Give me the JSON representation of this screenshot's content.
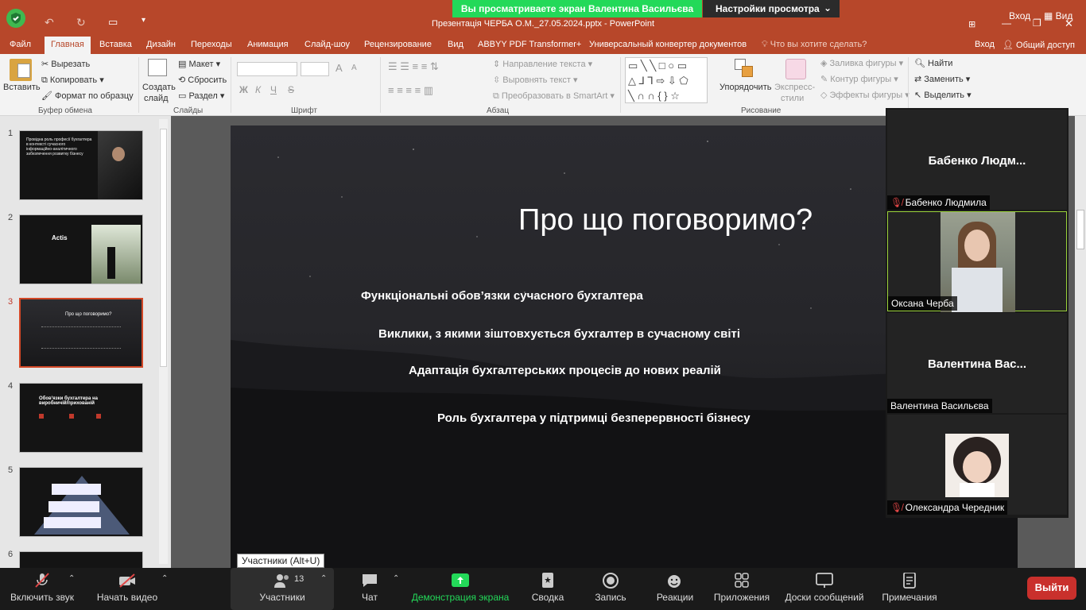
{
  "share_banner": {
    "text": "Вы просматриваете экран Валентина Васильєва",
    "view_options": "Настройки просмотра"
  },
  "window": {
    "title": "Презентація ЧЕРБА О.М._27.05.2024.pptx - PowerPoint",
    "login_top": "Вход",
    "view_btn": "Вид",
    "login": "Вход",
    "share": "Общий доступ"
  },
  "menu": [
    "Файл",
    "Главная",
    "Вставка",
    "Дизайн",
    "Переходы",
    "Анимация",
    "Слайд-шоу",
    "Рецензирование",
    "Вид",
    "ABBYY PDF Transformer+",
    "Универсальный конвертер документов"
  ],
  "tell_me": "Что вы хотите сделать?",
  "ribbon": {
    "paste": "Вставить",
    "cut": "Вырезать",
    "copy": "Копировать",
    "format_painter": "Формат по образцу",
    "new_slide_1": "Создать",
    "new_slide_2": "слайд",
    "layout": "Макет",
    "reset": "Сбросить",
    "section": "Раздел",
    "bold": "Ж",
    "italic": "К",
    "underline": "Ч",
    "strike": "S",
    "font_grow": "A",
    "font_shrink": "A",
    "text_direction": "Направление текста",
    "align_text": "Выровнять текст",
    "smartart": "Преобразовать в SmartArt",
    "arrange": "Упорядочить",
    "quick_styles_1": "Экспресс-",
    "quick_styles_2": "стили",
    "shape_fill": "Заливка фигуры",
    "shape_outline": "Контур фигуры",
    "shape_effects": "Эффекты фигуры",
    "find": "Найти",
    "replace": "Заменить",
    "select": "Выделить",
    "groups": {
      "clipboard": "Буфер обмена",
      "slides": "Слайды",
      "font": "Шрифт",
      "paragraph": "Абзац",
      "drawing": "Рисование"
    }
  },
  "thumbs": [
    {
      "num": "1",
      "text": "Провідна роль професії бухгалтера в контексті сучасного інформаційно-аналітичного забезпечення розвитку бізнесу"
    },
    {
      "num": "2",
      "text": "Actis"
    },
    {
      "num": "3",
      "text": "Про що поговоримо?"
    },
    {
      "num": "4",
      "text": "Обов'язки бухгалтера на виробничій/прихованій"
    },
    {
      "num": "5",
      "text": ""
    },
    {
      "num": "6",
      "text": ""
    }
  ],
  "slide": {
    "title": "Про що поговоримо?",
    "items": [
      "Функціональні обов’язки сучасного бухгалтера",
      "Виклики, з якими зіштовхується бухгалтер в сучасному світі",
      "Адаптація бухгалтерських процесів до нових реалій",
      "Роль бухгалтера у підтримці безперервності бізнесу"
    ]
  },
  "tooltip": "Участники (Alt+U)",
  "gallery": [
    {
      "big": "Бабенко  Людм...",
      "name": "Бабенко Людмила",
      "muted": true
    },
    {
      "big": "",
      "name": "Оксана Черба",
      "muted": false
    },
    {
      "big": "Валентина  Вас...",
      "name": "Валентина Васильєва",
      "muted": false
    },
    {
      "big": "",
      "name": "Олександра Чередник",
      "muted": true
    }
  ],
  "toolbar": {
    "unmute": "Включить звук",
    "start_video": "Начать видео",
    "participants": "Участники",
    "participants_count": "13",
    "chat": "Чат",
    "share": "Демонстрация экрана",
    "summary": "Сводка",
    "record": "Запись",
    "reactions": "Реакции",
    "apps": "Приложения",
    "whiteboards": "Доски сообщений",
    "notes": "Примечания",
    "leave": "Выйти"
  },
  "colors": {
    "pp_accent": "#b7472a",
    "share_green": "#23d959",
    "leave_red": "#c9302c",
    "active_speaker": "#9bd33a"
  }
}
